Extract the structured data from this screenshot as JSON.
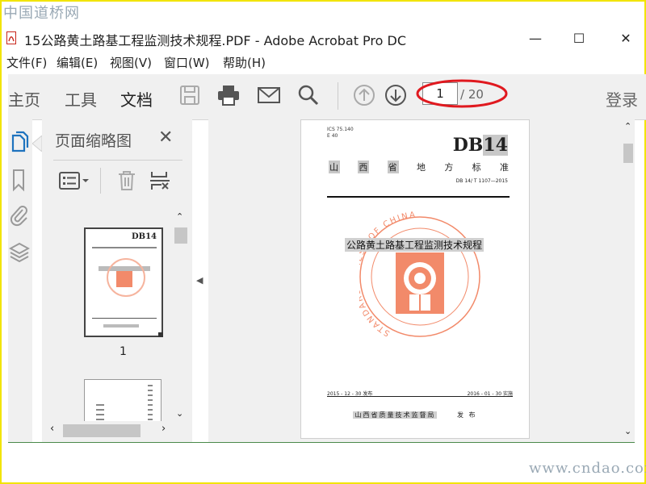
{
  "watermark_top": "中国道桥网",
  "watermark_bottom": "www.cndao.com",
  "window": {
    "title": "15公路黄土路基工程监测技术规程.PDF - Adobe Acrobat Pro DC",
    "minimize": "—",
    "maximize": "☐",
    "close": "✕"
  },
  "menu": [
    "文件(F)",
    "编辑(E)",
    "视图(V)",
    "窗口(W)",
    "帮助(H)"
  ],
  "toolbar": {
    "tabs": [
      "主页",
      "工具",
      "文档"
    ],
    "page_current": "1",
    "page_total": "/ 20",
    "login": "登录"
  },
  "thumbnails_panel": {
    "title": "页面缩略图",
    "close": "✕",
    "page_label": "1"
  },
  "document_page": {
    "ics": "ICS  75.140",
    "ccs": "E 40",
    "db_prefix": "DB",
    "db_code": "14",
    "province_chars": [
      "山",
      "西",
      "省",
      "地",
      "方",
      "标",
      "准"
    ],
    "std_number": "DB 14/ T 1107—2015",
    "title": "公路黄土路基工程监测技术规程",
    "seal_text": "STANDARDS PRESS OF CHINA",
    "issue_date": "2015 - 12 - 30 发布",
    "effective_date": "2016 - 01 - 30 实施",
    "publisher": "山西省质量技术监督局",
    "publish_word": "发 布"
  },
  "colors": {
    "seal": "#f28a6a",
    "annotation_ellipse": "#e0191f",
    "frame": "#f2e400"
  }
}
